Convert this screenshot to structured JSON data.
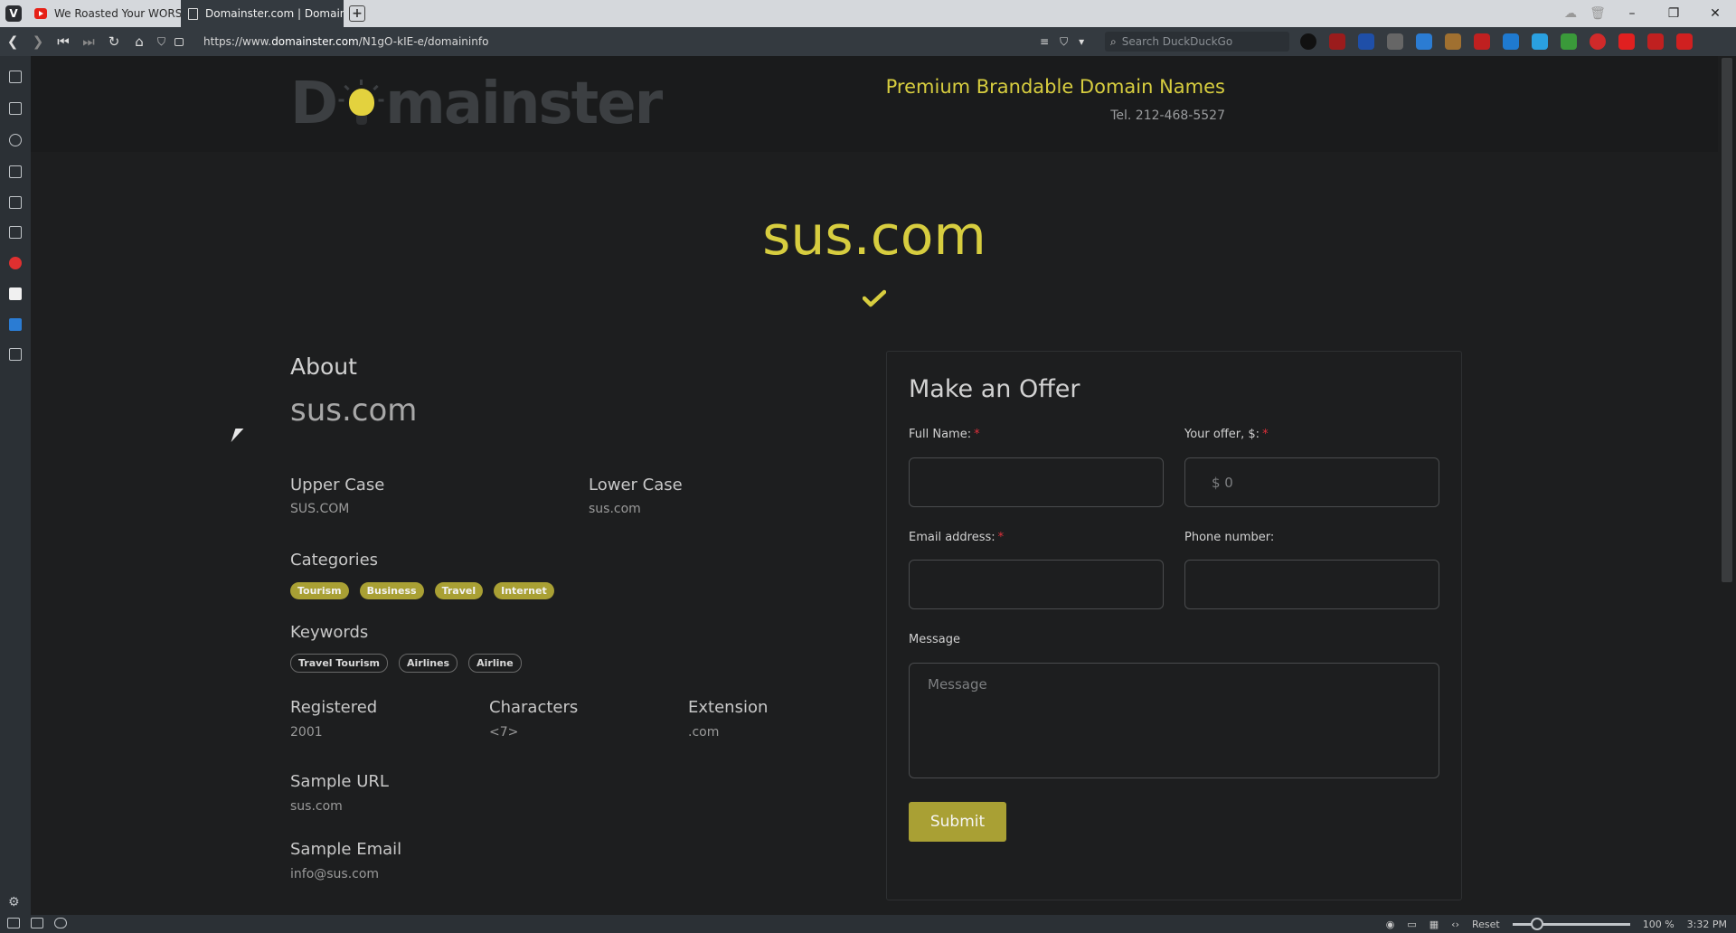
{
  "browser": {
    "tabs": [
      {
        "label": "We Roasted Your WORST S",
        "favicon": "youtube-icon",
        "active": false
      },
      {
        "label": "Domainster.com | Domain I",
        "favicon": "document-icon",
        "active": true
      }
    ],
    "url_prefix": "https://www.",
    "url_domain": "domainster.com",
    "url_path": "/N1gO-kIE-e/domaininfo",
    "search_placeholder": "Search DuckDuckGo",
    "status": {
      "reset_label": "Reset",
      "zoom": "100 %",
      "clock": "3:32 PM"
    }
  },
  "header": {
    "logo_left": "D",
    "logo_right": "mainster",
    "tagline": "Premium Brandable Domain Names",
    "phone": "Tel. 212-468-5527"
  },
  "domain": "sus.com",
  "about": {
    "heading": "About",
    "name": "sus.com",
    "upper_label": "Upper Case",
    "upper_value": "SUS.COM",
    "lower_label": "Lower Case",
    "lower_value": "sus.com",
    "categories_label": "Categories",
    "categories": [
      "Tourism",
      "Business",
      "Travel",
      "Internet"
    ],
    "keywords_label": "Keywords",
    "keywords": [
      "Travel Tourism",
      "Airlines",
      "Airline"
    ],
    "registered_label": "Registered",
    "registered_value": "2001",
    "characters_label": "Characters",
    "characters_value": "<7>",
    "extension_label": "Extension",
    "extension_value": ".com",
    "sample_url_label": "Sample URL",
    "sample_url_value": "sus.com",
    "sample_email_label": "Sample Email",
    "sample_email_value": "info@sus.com"
  },
  "offer": {
    "heading": "Make an Offer",
    "full_name_label": "Full Name:",
    "offer_label": "Your offer, $:",
    "offer_placeholder": "$ 0",
    "email_label": "Email address:",
    "phone_label": "Phone number:",
    "message_label": "Message",
    "message_placeholder": "Message",
    "required_mark": "*",
    "submit_label": "Submit"
  },
  "colors": {
    "accent": "#d7cd3f",
    "button": "#a9a034",
    "background": "#1d1e1f",
    "required": "#e0303a"
  }
}
